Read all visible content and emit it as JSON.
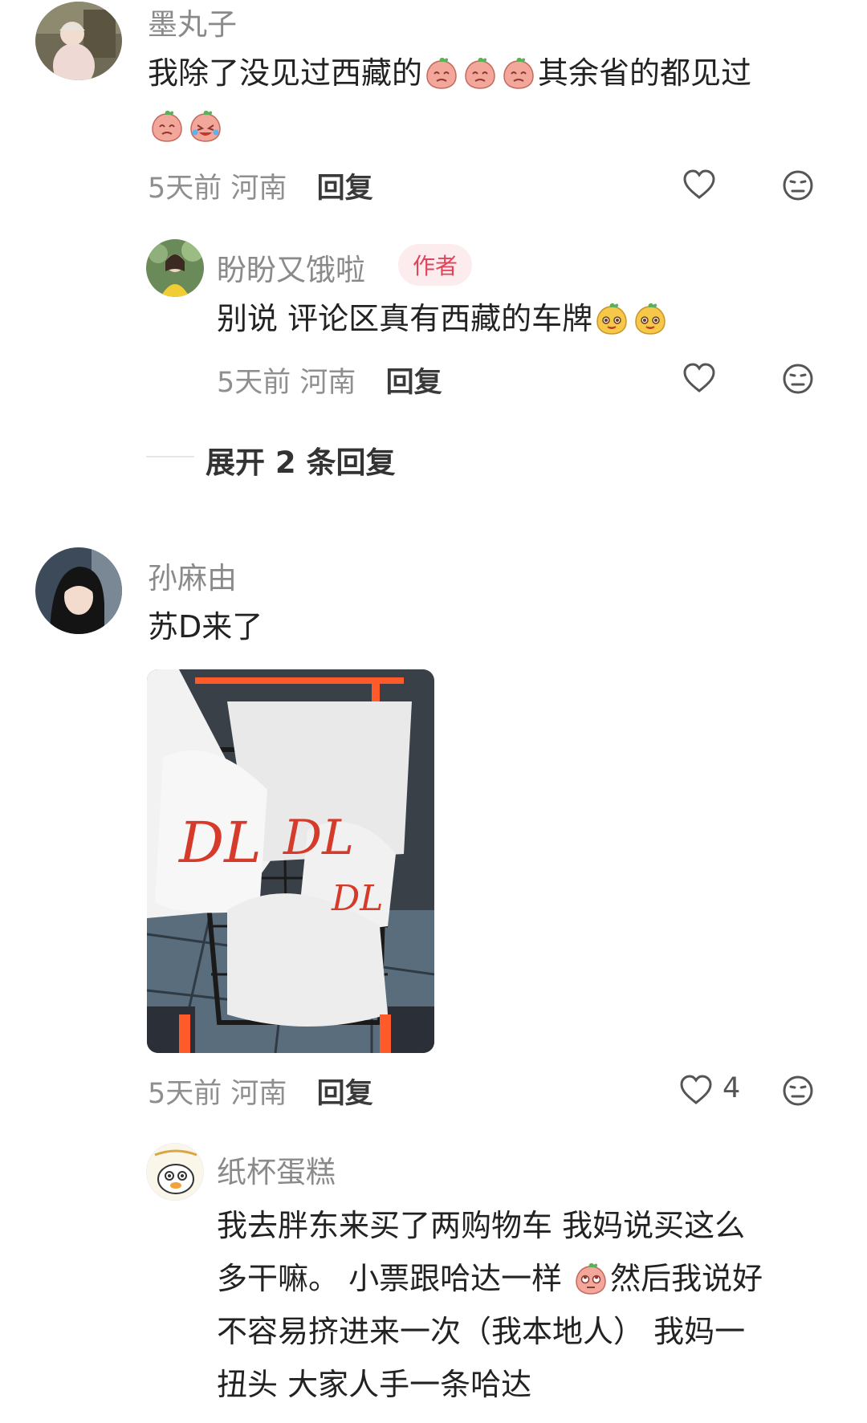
{
  "comments": [
    {
      "username": "墨丸子",
      "text_before": "我除了没见过西藏的",
      "text_after": "其余省的都见过",
      "time": "5天前",
      "location": "河南",
      "reply_label": "回复",
      "emojis": [
        "peach-crying-emoji",
        "peach-crying-emoji",
        "peach-crying-emoji",
        "peach-crying-emoji",
        "peach-laughing-tears-emoji"
      ],
      "reply": {
        "username": "盼盼又饿啦",
        "badge": "作者",
        "text": "别说 评论区真有西藏的车牌",
        "emojis": [
          "peach-cheeky-emoji",
          "peach-cheeky-emoji"
        ],
        "time": "5天前",
        "location": "河南",
        "reply_label": "回复"
      },
      "expand_label": "展开 2 条回复"
    },
    {
      "username": "孙麻由",
      "text": "苏D来了",
      "photo": "shopping cart with white DL bags",
      "time": "5天前",
      "location": "河南",
      "reply_label": "回复",
      "like_count": "4",
      "reply": {
        "username": "纸杯蛋糕",
        "line1": "我去胖东来买了两购物车  我妈说买这么",
        "line2_before": "多干嘛。 小票跟哈达一样 ",
        "line2_after": "然后我说好",
        "line3": "不容易挤进来一次（我本地人） 我妈一",
        "line4": "扭头  大家人手一条哈达",
        "emojis": [
          "peach-eyeroll-emoji"
        ]
      }
    }
  ],
  "colors": {
    "accent": "#e0445a",
    "peach": "#f3a79a",
    "yellow": "#f5c84a"
  }
}
